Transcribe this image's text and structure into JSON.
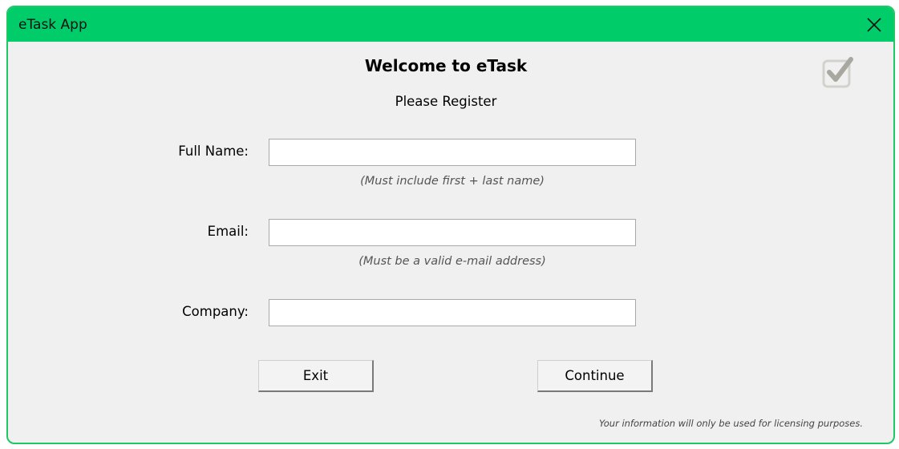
{
  "window": {
    "title": "eTask App",
    "accent_color": "#00cc6a"
  },
  "icons": {
    "close": "close-icon",
    "logo": "checkbox-logo-icon"
  },
  "header": {
    "title": "Welcome to eTask",
    "subtitle": "Please Register"
  },
  "form": {
    "full_name": {
      "label": "Full Name:",
      "value": "",
      "placeholder": "",
      "hint": "(Must include first + last name)"
    },
    "email": {
      "label": "Email:",
      "value": "",
      "placeholder": "",
      "hint": "(Must be a valid e-mail address)"
    },
    "company": {
      "label": "Company:",
      "value": "",
      "placeholder": ""
    }
  },
  "buttons": {
    "exit_label": "Exit",
    "continue_label": "Continue"
  },
  "footer": {
    "note": "Your information will only be used for licensing purposes."
  }
}
